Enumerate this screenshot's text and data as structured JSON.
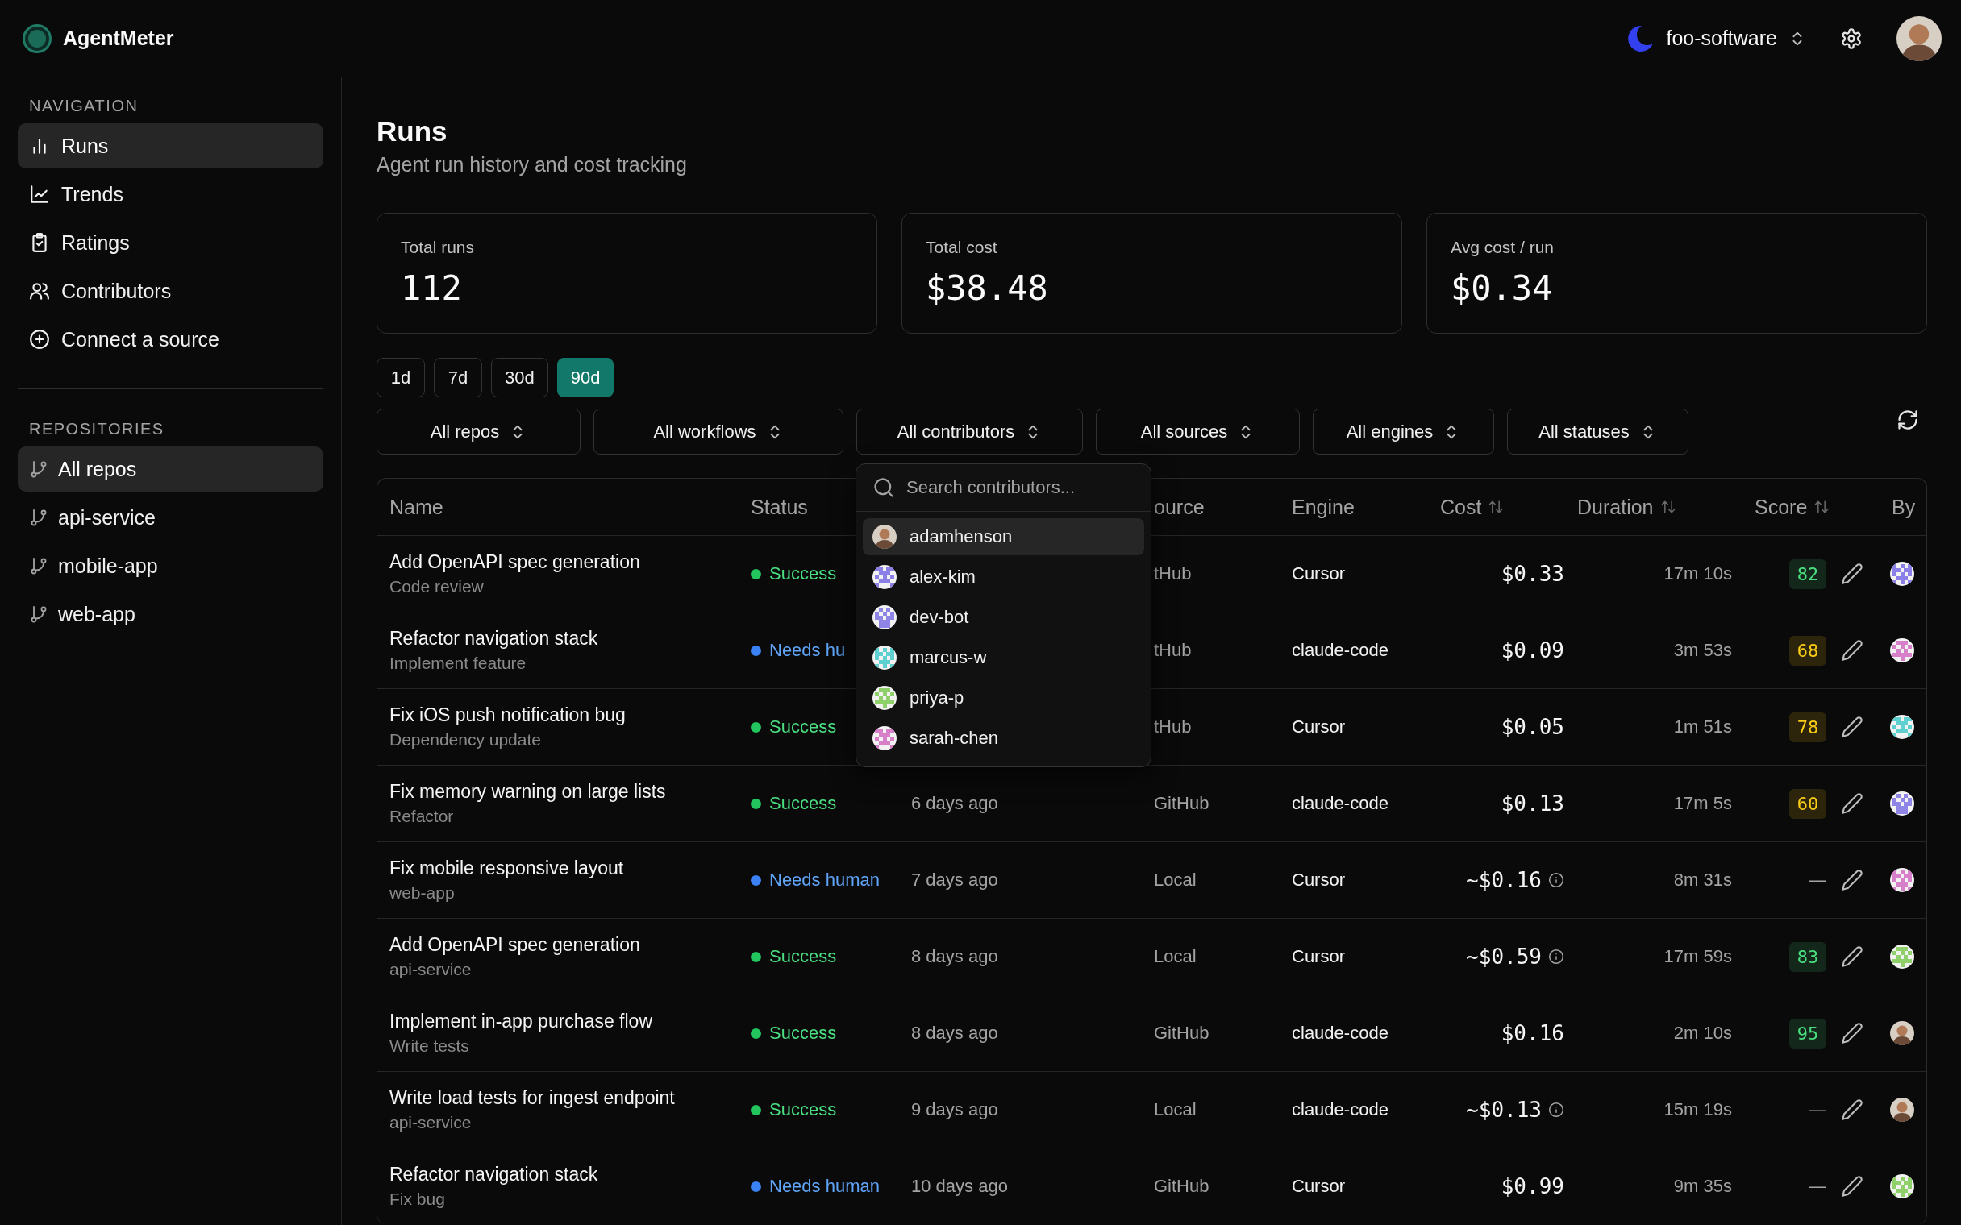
{
  "app": {
    "name": "AgentMeter"
  },
  "org": {
    "name": "foo-software"
  },
  "sidebar": {
    "sections": [
      {
        "title": "NAVIGATION",
        "items": [
          {
            "label": "Runs",
            "kind": "bars",
            "selected": true
          },
          {
            "label": "Trends",
            "kind": "trend",
            "selected": false
          },
          {
            "label": "Ratings",
            "kind": "clipboard",
            "selected": false
          },
          {
            "label": "Contributors",
            "kind": "users",
            "selected": false
          },
          {
            "label": "Connect a source",
            "kind": "plus",
            "selected": false
          }
        ]
      },
      {
        "title": "REPOSITORIES",
        "items": [
          {
            "label": "All repos",
            "kind": "branch",
            "selected": true
          },
          {
            "label": "api-service",
            "kind": "branch",
            "selected": false
          },
          {
            "label": "mobile-app",
            "kind": "branch",
            "selected": false
          },
          {
            "label": "web-app",
            "kind": "branch",
            "selected": false
          }
        ]
      }
    ]
  },
  "page": {
    "title": "Runs",
    "subtitle": "Agent run history and cost tracking"
  },
  "stats": [
    {
      "label": "Total runs",
      "value": "112"
    },
    {
      "label": "Total cost",
      "value": "$38.48"
    },
    {
      "label": "Avg cost / run",
      "value": "$0.34"
    }
  ],
  "ranges": [
    {
      "label": "1d",
      "selected": false
    },
    {
      "label": "7d",
      "selected": false
    },
    {
      "label": "30d",
      "selected": false
    },
    {
      "label": "90d",
      "selected": true
    }
  ],
  "filters": [
    "All repos",
    "All workflows",
    "All contributors",
    "All sources",
    "All engines",
    "All statuses"
  ],
  "contributor_menu": {
    "placeholder": "Search contributors...",
    "items": [
      {
        "name": "adamhenson",
        "avatar": {
          "kind": "photo"
        },
        "selected": true
      },
      {
        "name": "alex-kim",
        "avatar": {
          "kind": "identicon",
          "color": "#8b80e8"
        },
        "selected": false
      },
      {
        "name": "dev-bot",
        "avatar": {
          "kind": "identicon",
          "color": "#8f85e6"
        },
        "selected": false
      },
      {
        "name": "marcus-w",
        "avatar": {
          "kind": "identicon",
          "color": "#5fd0d0"
        },
        "selected": false
      },
      {
        "name": "priya-p",
        "avatar": {
          "kind": "identicon",
          "color": "#8fd06b"
        },
        "selected": false
      },
      {
        "name": "sarah-chen",
        "avatar": {
          "kind": "identicon",
          "color": "#d77fc9"
        },
        "selected": false
      }
    ]
  },
  "table": {
    "columns": [
      {
        "label": "Name",
        "sortable": false
      },
      {
        "label": "Status",
        "sortable": false
      },
      {
        "label": "ource",
        "sortable": false
      },
      {
        "label": "Engine",
        "sortable": false
      },
      {
        "label": "Cost",
        "sortable": true
      },
      {
        "label": "Duration",
        "sortable": true
      },
      {
        "label": "Score",
        "sortable": true
      },
      {
        "label": "By",
        "sortable": false
      }
    ],
    "rows": [
      {
        "name": "Add OpenAPI spec generation",
        "subtitle": "Code review",
        "status": {
          "kind": "success",
          "label": "Success"
        },
        "source": "tHub",
        "engine": "Cursor",
        "cost": "$0.33",
        "estimated": false,
        "duration": "17m 10s",
        "score": {
          "value": "82",
          "color": "#4ade80"
        },
        "by": {
          "kind": "identicon",
          "color": "#8b80e8"
        }
      },
      {
        "name": "Refactor navigation stack",
        "subtitle": "Implement feature",
        "status": {
          "kind": "needs_human",
          "label": "Needs hu"
        },
        "source": "tHub",
        "engine": "claude-code",
        "cost": "$0.09",
        "estimated": false,
        "duration": "3m 53s",
        "score": {
          "value": "68",
          "color": "#facc15"
        },
        "by": {
          "kind": "identicon",
          "color": "#d77fc9"
        }
      },
      {
        "name": "Fix iOS push notification bug",
        "subtitle": "Dependency update",
        "status": {
          "kind": "success",
          "label": "Success"
        },
        "source": "tHub",
        "engine": "Cursor",
        "cost": "$0.05",
        "estimated": false,
        "duration": "1m 51s",
        "score": {
          "value": "78",
          "color": "#facc15"
        },
        "by": {
          "kind": "identicon",
          "color": "#5fd0d0"
        }
      },
      {
        "name": "Fix memory warning on large lists",
        "subtitle": "Refactor",
        "status": {
          "kind": "success",
          "label": "Success"
        },
        "date": "6 days ago",
        "source": "GitHub",
        "engine": "claude-code",
        "cost": "$0.13",
        "estimated": false,
        "duration": "17m 5s",
        "score": {
          "value": "60",
          "color": "#facc15"
        },
        "by": {
          "kind": "identicon",
          "color": "#8f85e6"
        }
      },
      {
        "name": "Fix mobile responsive layout",
        "subtitle": "web-app",
        "status": {
          "kind": "needs_human",
          "label": "Needs human"
        },
        "date": "7 days ago",
        "source": "Local",
        "engine": "Cursor",
        "cost": "~$0.16",
        "estimated": true,
        "duration": "8m 31s",
        "score": {
          "value": "—"
        },
        "by": {
          "kind": "identicon",
          "color": "#d77fc9"
        }
      },
      {
        "name": "Add OpenAPI spec generation",
        "subtitle": "api-service",
        "status": {
          "kind": "success",
          "label": "Success"
        },
        "date": "8 days ago",
        "source": "Local",
        "engine": "Cursor",
        "cost": "~$0.59",
        "estimated": true,
        "duration": "17m 59s",
        "score": {
          "value": "83",
          "color": "#4ade80"
        },
        "by": {
          "kind": "identicon",
          "color": "#8fd06b"
        }
      },
      {
        "name": "Implement in-app purchase flow",
        "subtitle": "Write tests",
        "status": {
          "kind": "success",
          "label": "Success"
        },
        "date": "8 days ago",
        "source": "GitHub",
        "engine": "claude-code",
        "cost": "$0.16",
        "estimated": false,
        "duration": "2m 10s",
        "score": {
          "value": "95",
          "color": "#4ade80"
        },
        "by": {
          "kind": "photo"
        }
      },
      {
        "name": "Write load tests for ingest endpoint",
        "subtitle": "api-service",
        "status": {
          "kind": "success",
          "label": "Success"
        },
        "date": "9 days ago",
        "source": "Local",
        "engine": "claude-code",
        "cost": "~$0.13",
        "estimated": true,
        "duration": "15m 19s",
        "score": {
          "value": "—"
        },
        "by": {
          "kind": "photo"
        }
      },
      {
        "name": "Refactor navigation stack",
        "subtitle": "Fix bug",
        "status": {
          "kind": "needs_human",
          "label": "Needs human"
        },
        "date": "10 days ago",
        "source": "GitHub",
        "engine": "Cursor",
        "cost": "$0.99",
        "estimated": false,
        "duration": "9m 35s",
        "score": {
          "value": "—"
        },
        "by": {
          "kind": "identicon",
          "color": "#8fd06b"
        }
      }
    ]
  }
}
